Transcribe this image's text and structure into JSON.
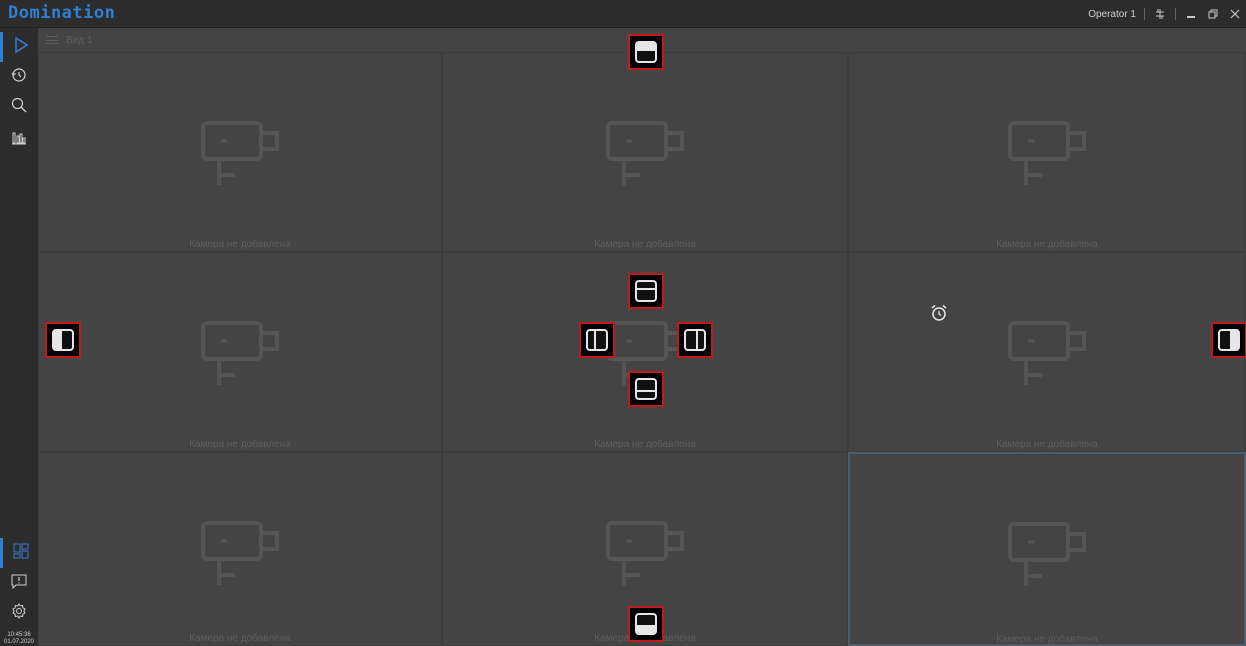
{
  "app": {
    "logo": "Domination",
    "user": "Operator 1",
    "window_controls": [
      "network-icon",
      "minimize-icon",
      "restore-icon",
      "close-icon"
    ]
  },
  "sidebar": {
    "top_items": [
      "play-icon",
      "history-icon",
      "search-icon",
      "stats-icon"
    ],
    "bottom_items": [
      "layout-grid-icon",
      "alert-message-icon",
      "settings-icon"
    ],
    "clock_time": "10:45:36",
    "clock_date": "01.07.2020"
  },
  "view": {
    "title": "Вид 1"
  },
  "grid": {
    "rows": 3,
    "cols": 3,
    "cells": [
      {
        "label": "Камера не добавлена"
      },
      {
        "label": "Камера не добавлена"
      },
      {
        "label": "Камера не добавлена"
      },
      {
        "label": "Камера не добавлена"
      },
      {
        "label": "Камера не добавлена"
      },
      {
        "label": "Камера не добавлена"
      },
      {
        "label": "Камера не добавлена"
      },
      {
        "label": "Камера не добавлена"
      },
      {
        "label": "Камера не добавлена"
      }
    ],
    "selected_cell": 8
  },
  "dock_targets": [
    "dock-top",
    "dock-left",
    "dock-right",
    "dock-bottom",
    "dock-center-top",
    "dock-center-left",
    "dock-center-right",
    "dock-center-bottom"
  ],
  "colors": {
    "accent": "#2f7fd3",
    "dock_border": "#c11a1a",
    "background": "#444444",
    "panel": "#2c2c2c"
  }
}
